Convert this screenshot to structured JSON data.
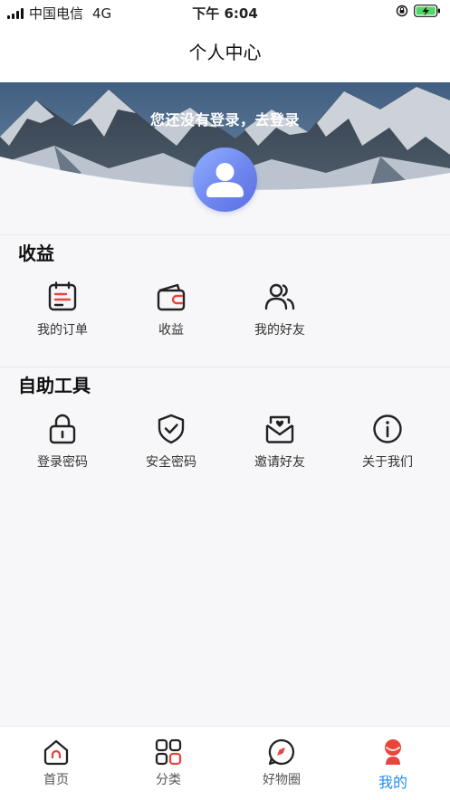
{
  "status_bar": {
    "carrier": "中国电信",
    "network": "4G",
    "time": "下午 6:04"
  },
  "header": {
    "title": "个人中心"
  },
  "banner": {
    "login_prompt": "您还没有登录，去登录"
  },
  "sections": {
    "earnings": {
      "title": "收益",
      "items": [
        {
          "label": "我的订单",
          "icon": "order-calendar-icon"
        },
        {
          "label": "收益",
          "icon": "wallet-icon"
        },
        {
          "label": "我的好友",
          "icon": "friends-icon"
        }
      ]
    },
    "tools": {
      "title": "自助工具",
      "items": [
        {
          "label": "登录密码",
          "icon": "lock-icon"
        },
        {
          "label": "安全密码",
          "icon": "shield-check-icon"
        },
        {
          "label": "邀请好友",
          "icon": "invite-mail-icon"
        },
        {
          "label": "关于我们",
          "icon": "info-icon"
        }
      ]
    }
  },
  "tab_bar": {
    "active_index": 3,
    "tabs": [
      {
        "label": "首页",
        "icon": "home-icon"
      },
      {
        "label": "分类",
        "icon": "category-grid-icon"
      },
      {
        "label": "好物圈",
        "icon": "compass-chat-icon"
      },
      {
        "label": "我的",
        "icon": "profile-icon"
      }
    ]
  },
  "colors": {
    "accent": "#1f8ef1",
    "brand_red": "#e8453c",
    "avatar_blue": "#6f86ef",
    "battery_green": "#4cd964"
  }
}
